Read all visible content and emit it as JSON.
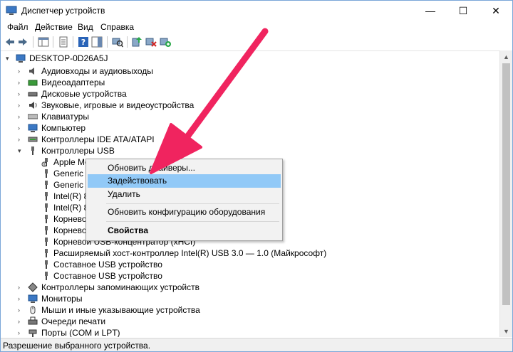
{
  "window": {
    "title": "Диспетчер устройств",
    "minimize_glyph": "—",
    "maximize_glyph": "☐",
    "close_glyph": "✕"
  },
  "menu": [
    "Файл",
    "Действие",
    "Вид",
    "Справка"
  ],
  "tree": {
    "root": "DESKTOP-0D26A5J",
    "categories_top": [
      "Аудиовходы и аудиовыходы",
      "Видеоадаптеры",
      "Дисковые устройства",
      "Звуковые, игровые и видеоустройства",
      "Клавиатуры",
      "Компьютер",
      "Контроллеры IDE ATA/ATAPI"
    ],
    "usb_category": "Контроллеры USB",
    "usb_children": [
      "Apple Mo",
      "Generic U",
      "Generic U",
      "Intel(R) 8",
      "Intel(R) 8",
      "Корневой",
      "Корневой",
      "Корневой USB-концентратор (xHCI)",
      "Расширяемый хост-контроллер Intel(R) USB 3.0 — 1.0 (Майкрософт)",
      "Составное USB устройство",
      "Составное USB устройство"
    ],
    "categories_bottom": [
      "Контроллеры запоминающих устройств",
      "Мониторы",
      "Мыши и иные указывающие устройства",
      "Очереди печати",
      "Порты (COM и LPT)"
    ]
  },
  "context_menu": {
    "update": "Обновить драйверы...",
    "enable": "Задействовать",
    "delete": "Удалить",
    "scan": "Обновить конфигурацию оборудования",
    "properties": "Свойства"
  },
  "status": "Разрешение выбранного устройства.",
  "colors": {
    "arrow": "#f0245f",
    "highlight": "#91c9f7"
  }
}
